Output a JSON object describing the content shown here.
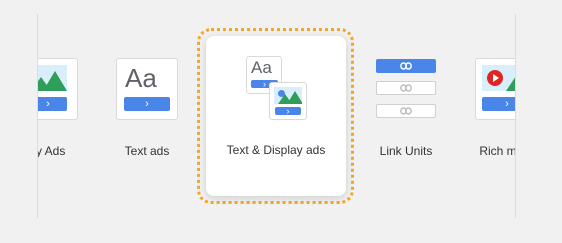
{
  "ad_types": [
    {
      "label": "Display Ads",
      "visible_label": "lay Ads"
    },
    {
      "label": "Text ads",
      "aa": "Aa",
      "chevron": "›"
    },
    {
      "label": "Text & Display ads",
      "aa": "Aa",
      "chevron": "›"
    },
    {
      "label": "Link Units"
    },
    {
      "label": "Rich media ads",
      "visible_label": "Rich m"
    }
  ],
  "selected": "Text & Display ads",
  "colors": {
    "accent": "#4a86e8",
    "selection": "#f5a623",
    "play": "#e02424",
    "mountain": "#2f9e5b"
  }
}
